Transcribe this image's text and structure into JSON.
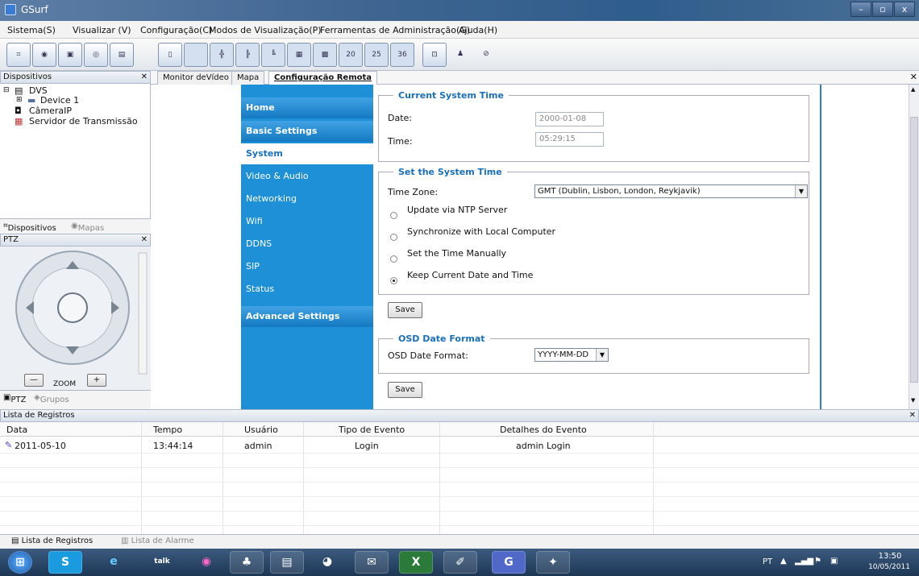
{
  "window": {
    "title": "GSurf",
    "controls": {
      "minimize": "–",
      "restore": "▫",
      "close": "x"
    }
  },
  "menu": [
    "Sistema(S)",
    "Visualizar (V)",
    "Configuração(C)",
    "Modos de Visualização(P)",
    "Ferramentas de Administração(G)",
    "Ajuda(H)"
  ],
  "toolbar": {
    "layout20": "20",
    "layout25": "25",
    "layout36": "36"
  },
  "devices_panel": {
    "title": "Dispositivos",
    "close": "✕",
    "tree": {
      "root": "DVS",
      "child": "Device 1",
      "camera": "CâmeraIP",
      "server": "Servidor de Transmissão"
    },
    "tabs": {
      "devices": "Dispositivos",
      "maps": "Mapas"
    }
  },
  "ptz_panel": {
    "title": "PTZ",
    "close": "✕",
    "zoom": "ZOOM",
    "minus": "—",
    "plus": "+",
    "tabs": {
      "ptz": "PTZ",
      "groups": "Grupos"
    }
  },
  "main_tabs": {
    "video": "Monitor deVídeo",
    "map": "Mapa",
    "remote": "Configuração Remota"
  },
  "nav": {
    "home": "Home",
    "basic": "Basic Settings",
    "system": "System",
    "video_audio": "Video & Audio",
    "networking": "Networking",
    "wifi": "Wifi",
    "ddns": "DDNS",
    "sip": "SIP",
    "status": "Status",
    "advanced": "Advanced Settings"
  },
  "current_time": {
    "title": "Current System Time",
    "date_label": "Date:",
    "date_value": "2000-01-08",
    "time_label": "Time:",
    "time_value": "05:29:15"
  },
  "set_time": {
    "title": "Set the System Time",
    "timezone_label": "Time Zone:",
    "timezone_value": "GMT (Dublin, Lisbon, London, Reykjavik)",
    "options": {
      "ntp": "Update via NTP Server",
      "sync": "Synchronize with Local Computer",
      "manual": "Set the Time Manually",
      "keep": "Keep Current Date and Time"
    },
    "selected": "keep",
    "save": "Save"
  },
  "osd": {
    "title": "OSD Date Format",
    "label": "OSD Date Format:",
    "value": "YYYY-MM-DD",
    "save": "Save"
  },
  "log": {
    "title": "Lista de Registros",
    "close": "✕",
    "columns": {
      "date": "Data",
      "time": "Tempo",
      "user": "Usuário",
      "event": "Tipo de Evento",
      "details": "Detalhes do Evento"
    },
    "rows": [
      {
        "date": "2011-05-10",
        "time": "13:44:14",
        "user": "admin",
        "event": "Login",
        "details": "admin Login"
      }
    ]
  },
  "bottom_tabs": {
    "records": "Lista de Registros",
    "alarms": "Lista de Alarme"
  },
  "taskbar": {
    "lang": "PT",
    "clock_time": "13:50",
    "clock_date": "10/05/2011",
    "talk": "talk"
  },
  "colors": {
    "nav_blue": "#1e90d8",
    "accent": "#1a6fb8",
    "title_bar": "#3f6591"
  }
}
